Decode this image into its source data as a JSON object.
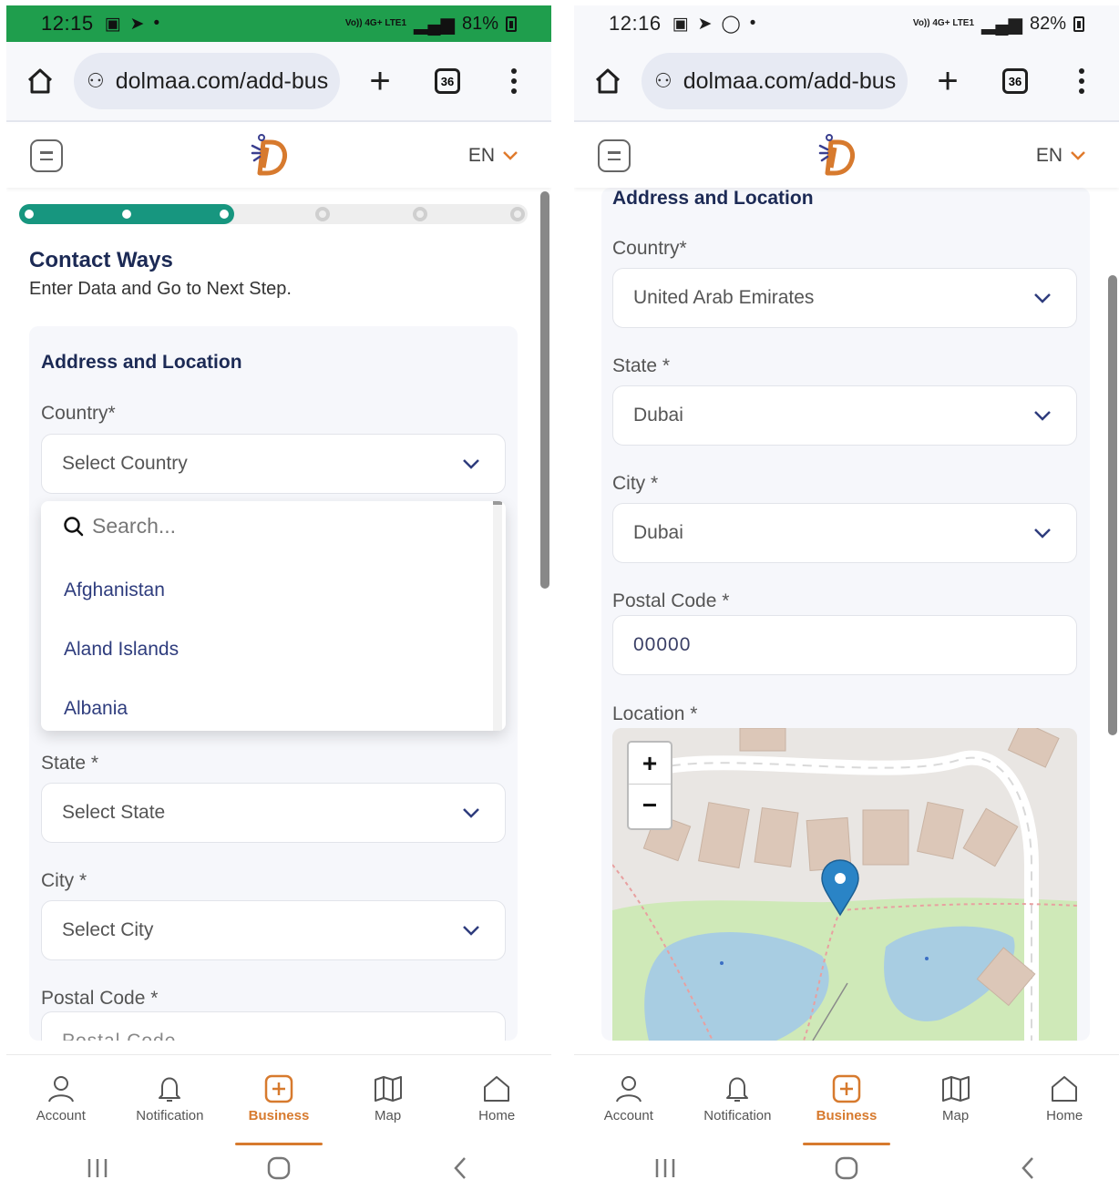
{
  "left": {
    "status": {
      "time": "12:15",
      "network": "Vo)) 4G+ LTE1",
      "battery": "81%"
    },
    "browser": {
      "url": "dolmaa.com/add-bus",
      "tab_count": "36"
    },
    "header": {
      "language": "EN"
    },
    "stepper": {
      "total_steps": 6,
      "current_step": 3
    },
    "page": {
      "title": "Contact Ways",
      "subtitle": "Enter Data and Go to Next Step."
    },
    "section_title": "Address and Location",
    "country": {
      "label": "Country*",
      "value": "Select Country"
    },
    "dropdown": {
      "search_placeholder": "Search...",
      "options": [
        "Afghanistan",
        "Aland Islands",
        "Albania"
      ]
    },
    "state": {
      "label": "State *",
      "value": "Select State"
    },
    "city": {
      "label": "City *",
      "value": "Select City"
    },
    "postal": {
      "label": "Postal Code *",
      "placeholder": "Postal Code"
    }
  },
  "right": {
    "status": {
      "time": "12:16",
      "network": "Vo)) 4G+ LTE1",
      "battery": "82%"
    },
    "browser": {
      "url": "dolmaa.com/add-bus",
      "tab_count": "36"
    },
    "header": {
      "language": "EN"
    },
    "section_title": "Address and Location",
    "country": {
      "label": "Country*",
      "value": "United Arab Emirates"
    },
    "state": {
      "label": "State *",
      "value": "Dubai"
    },
    "city": {
      "label": "City *",
      "value": "Dubai"
    },
    "postal": {
      "label": "Postal Code *",
      "value": "00000"
    },
    "location": {
      "label": "Location *"
    },
    "map": {
      "zoom_in": "+",
      "zoom_out": "−"
    }
  },
  "bottom_nav": [
    {
      "label": "Account",
      "icon": "account-icon",
      "active": false
    },
    {
      "label": "Notification",
      "icon": "bell-icon",
      "active": false
    },
    {
      "label": "Business",
      "icon": "add-business-icon",
      "active": true
    },
    {
      "label": "Map",
      "icon": "map-icon",
      "active": false
    },
    {
      "label": "Home",
      "icon": "home-icon",
      "active": false
    }
  ],
  "colors": {
    "primary_navy": "#1c2a55",
    "accent_orange": "#d77a2e",
    "progress_teal": "#17967f",
    "status_green": "#1f9e4d"
  }
}
